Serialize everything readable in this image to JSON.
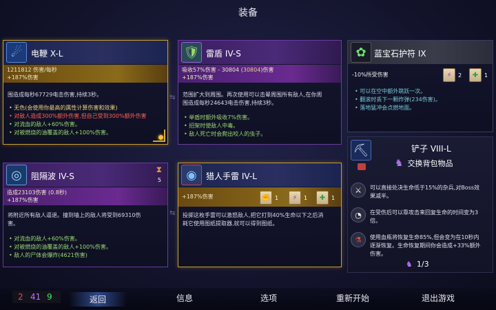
{
  "screen_title": "装备",
  "colors": {
    "gold": "#d8a828",
    "purple": "#6a3aa0",
    "red": "#ff6050",
    "green": "#9ad870",
    "blue": "#58a8ff"
  },
  "whip": {
    "name": "电鞭 X-L",
    "icon": "electric-whip-icon",
    "stats": "1211812 伤害/每秒",
    "bonus": "+187%伤害",
    "desc_line1": "围造成每秒67729电击伤害,持续3秒。",
    "bullets": [
      "无色(会使用你最高的属性计算伤害和效果)",
      "对敌人造成300%额外伤害,但自己受到300%额外伤害",
      "对流血的敌人+60%伤害。",
      "对被燃烧的油覆盖的敌人+100%伤害。"
    ]
  },
  "shield": {
    "name": "雷盾 IV-S",
    "icon": "thunder-shield-icon",
    "stats_prefix": "吸收57%伤害 - 30804 (",
    "stats_highlight": "30804",
    "stats_suffix": ")伤害",
    "bonus": "+187%伤害",
    "desc_line1": "范围扩大到周围。再次使用可以击晕周围所有敌人,在你周",
    "desc_line2": "围造成每秒24643电击伤害,持续3秒。",
    "bullets": [
      "举盾时额外吸收7%伤害。",
      "招架时使敌人中毒。",
      "敌人死亡时会爬出咬人的虫子。"
    ]
  },
  "amulet": {
    "name": "蓝宝石护符 IX",
    "icon": "sapphire-amulet-icon",
    "stats": "-10%所受伤害",
    "scroll1_count": "2",
    "scroll2_count": "1",
    "bullets": [
      "可以在空中额外跳跃一次。",
      "翻滚时丢下一颗炸弹(234伤害)。",
      "落地猛冲会点燃地面。"
    ]
  },
  "wave": {
    "name": "阻隔波 IV-S",
    "icon": "barrier-wave-icon",
    "cooldown": "5",
    "stats": "造成23103伤害 (0.8秒)",
    "bonus": "+187%伤害",
    "desc_line1": "将附近所有敌人逼退。撞到墙上的敌人将受到69310伤",
    "desc_line2": "害。",
    "bullets": [
      "对流血的敌人+60%伤害。",
      "对被燃烧的油覆盖的敌人+100%伤害。",
      "敌人的尸体会爆炸(4621伤害)"
    ]
  },
  "grenade": {
    "name": "猎人手雷 IV-L",
    "icon": "hunter-grenade-icon",
    "bonus": "+187%伤害",
    "scroll1_count": "1",
    "scroll2_count": "1",
    "scroll3_count": "1",
    "desc_line1": "投掷这枚手雷可以激怒敌人,把它打到40%生命以下之后消",
    "desc_line2": "耗它使用图纸提取器,就可以得到图纸。"
  },
  "shovel": {
    "name": "铲子 VIII-L",
    "icon": "shovel-icon",
    "swap_label": "交换背包物品",
    "rows": [
      {
        "icon": "execute-icon",
        "text1": "可以直接处决生命低于15%的杂兵,对Boss效",
        "text2": "果减半。"
      },
      {
        "icon": "recovery-icon",
        "text1": "在受伤后可以靠攻击来回复生命的时间变为3",
        "text2": "倍。"
      },
      {
        "icon": "flask-icon",
        "text1": "使用血瓶将恢复生命85%,但会变为在10秒内",
        "text2": "逐渐恢复。生命恢复期间你会造成+33%额外",
        "text3": "伤害。"
      }
    ],
    "page": "1/3"
  },
  "stats_bar": {
    "red": "2",
    "purple": "41",
    "green": "9"
  },
  "menu": {
    "back": "返回",
    "info": "信息",
    "options": "选项",
    "restart": "重新开始",
    "quit": "退出游戏"
  }
}
